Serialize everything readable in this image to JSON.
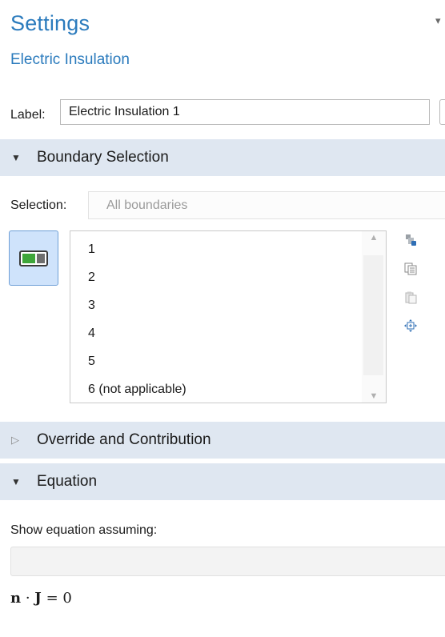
{
  "header": {
    "title": "Settings",
    "subtitle": "Electric Insulation"
  },
  "label_row": {
    "caption": "Label:",
    "value": "Electric Insulation 1"
  },
  "sections": {
    "boundary_selection": "Boundary Selection",
    "override": "Override and Contribution",
    "equation": "Equation"
  },
  "selection": {
    "caption": "Selection:",
    "value": "All boundaries",
    "items": [
      "1",
      "2",
      "3",
      "4",
      "5",
      "6 (not applicable)"
    ]
  },
  "side_icons": [
    "paste-selection-icon",
    "copy-selection-icon",
    "clear-selection-icon",
    "zoom-to-selection-icon"
  ],
  "equation": {
    "caption": "Show equation assuming:",
    "combo_value": "",
    "formula_left": "n",
    "formula_dot": "·",
    "formula_right": "J",
    "formula_eq": "= 0"
  },
  "colors": {
    "accent": "#2b7bbd",
    "section_bg": "#dfe7f1",
    "toggle_bg": "#cfe3fb",
    "toggle_green": "#3ea63a"
  }
}
